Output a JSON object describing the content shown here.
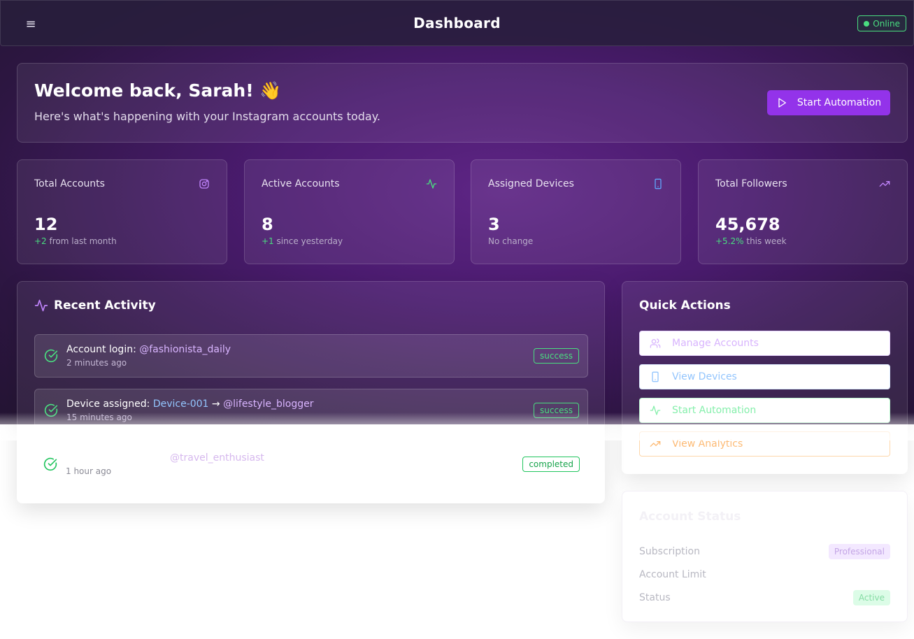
{
  "header": {
    "title": "Dashboard",
    "menu_icon": "hamburger-menu-icon",
    "status": "Online",
    "status_color": "#4ade80"
  },
  "welcome": {
    "heading": "Welcome back, Sarah! 👋",
    "subtitle": "Here's what's happening with your Instagram accounts today.",
    "cta": "Start Automation",
    "cta_color": "#9333ea"
  },
  "stats": [
    {
      "label": "Total Accounts",
      "value": "12",
      "delta": "+2",
      "delta_text": "from last month",
      "icon": "instagram-icon",
      "icon_color": "#c084fc"
    },
    {
      "label": "Active Accounts",
      "value": "8",
      "delta": "+1",
      "delta_text": "since yesterday",
      "icon": "activity-icon",
      "icon_color": "#4ade80"
    },
    {
      "label": "Assigned Devices",
      "value": "3",
      "delta": "",
      "delta_text": "No change",
      "icon": "smartphone-icon",
      "icon_color": "#60a5fa"
    },
    {
      "label": "Total Followers",
      "value": "45,678",
      "delta": "+5.2%",
      "delta_text": "this week",
      "icon": "trending-up-icon",
      "icon_color": "#c084fc"
    }
  ],
  "activity": {
    "title": "Recent Activity",
    "items": [
      {
        "prefix": "Account login: ",
        "target": "@fashionista_daily",
        "time": "2 minutes ago",
        "status": "success"
      },
      {
        "prefix": "Device assigned: ",
        "device": "Device-001",
        "arrow": " → ",
        "target": "@lifestyle_blogger",
        "time": "15 minutes ago",
        "status": "success"
      },
      {
        "prefix": "",
        "target": "@travel_enthusiast",
        "time": "1 hour ago",
        "status": "completed"
      }
    ]
  },
  "quick_actions": {
    "title": "Quick Actions",
    "buttons": [
      {
        "label": "Manage Accounts",
        "icon": "users-icon",
        "color": "#d8b4fe"
      },
      {
        "label": "View Devices",
        "icon": "smartphone-icon",
        "color": "#93c5fd"
      },
      {
        "label": "Start Automation",
        "icon": "activity-icon",
        "color": "#86efac"
      },
      {
        "label": "View Analytics",
        "icon": "trending-up-icon",
        "color": "#fdba74"
      }
    ]
  },
  "account_status": {
    "title": "Account Status",
    "rows": [
      {
        "key": "Subscription",
        "value": "Professional"
      },
      {
        "key": "Account Limit",
        "value": ""
      },
      {
        "key": "Status",
        "value": "Active"
      }
    ]
  }
}
